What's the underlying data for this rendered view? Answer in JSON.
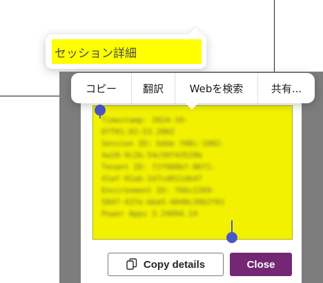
{
  "tooltip": {
    "label": "セッション詳細"
  },
  "context_menu": {
    "items": [
      "コピー",
      "翻訳",
      "Webを検索",
      "共有..."
    ]
  },
  "details": {
    "lines": [
      "Timestamp: 2024-10-",
      "07T01:02:53.280Z",
      "Session ID: bdde f08c-1082-",
      "4a10-9c2b-54c50f43529b",
      "Tenant ID: 72f988bf-86f1-",
      "41af-91ab-2d7cd011db47",
      "Environment ID: f66c2269-",
      "5847-437e-bba5-4048c39b2f61",
      "Power Apps 3.24094.14"
    ]
  },
  "buttons": {
    "copy_details": "Copy details",
    "close": "Close"
  },
  "colors": {
    "highlight": "#ffff00",
    "primary": "#742774",
    "selection_handle": "#4a57c9"
  },
  "icons": {
    "copy": "copy-icon"
  }
}
